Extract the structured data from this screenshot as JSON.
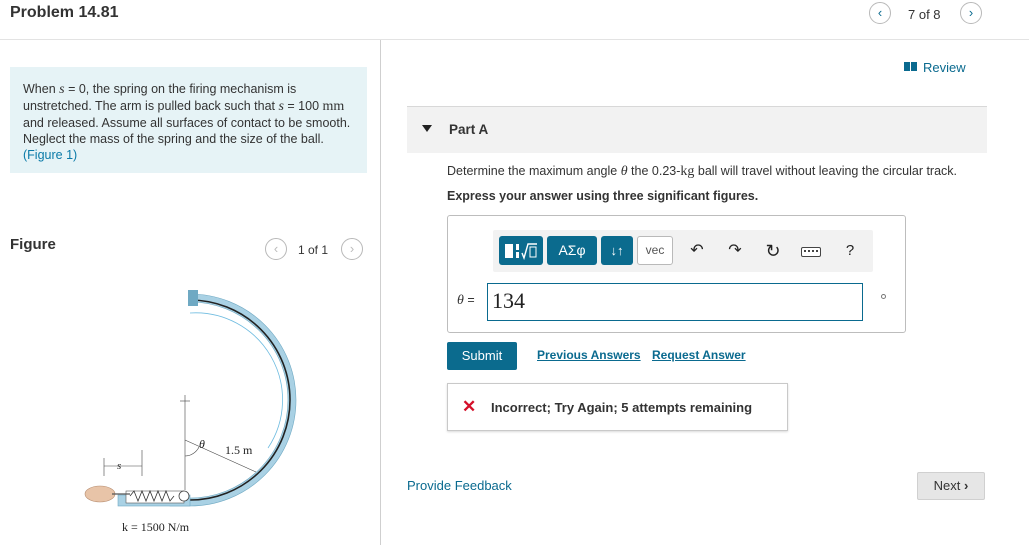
{
  "header": {
    "problem_title": "Problem 14.81",
    "pager_text": "7 of 8",
    "prev_icon": "chevron-left",
    "next_icon": "chevron-right"
  },
  "intro": {
    "t1": "When ",
    "s_var": "s",
    "t2": " = 0, the spring on the firing mechanism is unstretched. The arm is pulled back such that ",
    "s_var2": "s",
    "t3": " = 100 ",
    "mm_unit": "mm",
    "t4": " and released. Assume all surfaces of contact to be smooth. Neglect the mass of the spring and the size of the ball. ",
    "figure_link": "(Figure 1)"
  },
  "figure": {
    "heading": "Figure",
    "pager_text": "1 of 1",
    "labels": {
      "theta": "θ",
      "radius": "1.5 m",
      "s": "s",
      "spring_k": "k = 1500 N/m"
    }
  },
  "review": {
    "label": "Review"
  },
  "part": {
    "label": "Part A"
  },
  "question": {
    "t1": "Determine the maximum angle ",
    "theta": "θ",
    "t2": " the 0.23-",
    "kg_unit": "kg",
    "t3": " ball will travel without leaving the circular track."
  },
  "instruction": "Express your answer using three significant figures.",
  "toolbar": {
    "template_icon": "fraction-sqrt-icon",
    "symbols_label": "ΑΣφ",
    "arrows_label": "↓↑",
    "vec_label": "vec",
    "undo_icon": "undo",
    "redo_icon": "redo",
    "reset_icon": "reset",
    "keyboard_icon": "keyboard",
    "help_label": "?"
  },
  "answer": {
    "label_var": "θ",
    "label_eq": " = ",
    "value": "134"
  },
  "actions": {
    "submit_label": "Submit",
    "previous_answers": "Previous Answers",
    "request_answer": "Request Answer"
  },
  "feedback": {
    "icon": "✕",
    "text": "Incorrect; Try Again; 5 attempts remaining"
  },
  "footer": {
    "provide_feedback": "Provide Feedback",
    "next_label": "Next"
  },
  "colors": {
    "accent": "#0b6b8e",
    "link": "#0a7aa8",
    "intro_bg": "#e6f3f6",
    "error": "#d4102a",
    "track": "#a9d1e4"
  }
}
